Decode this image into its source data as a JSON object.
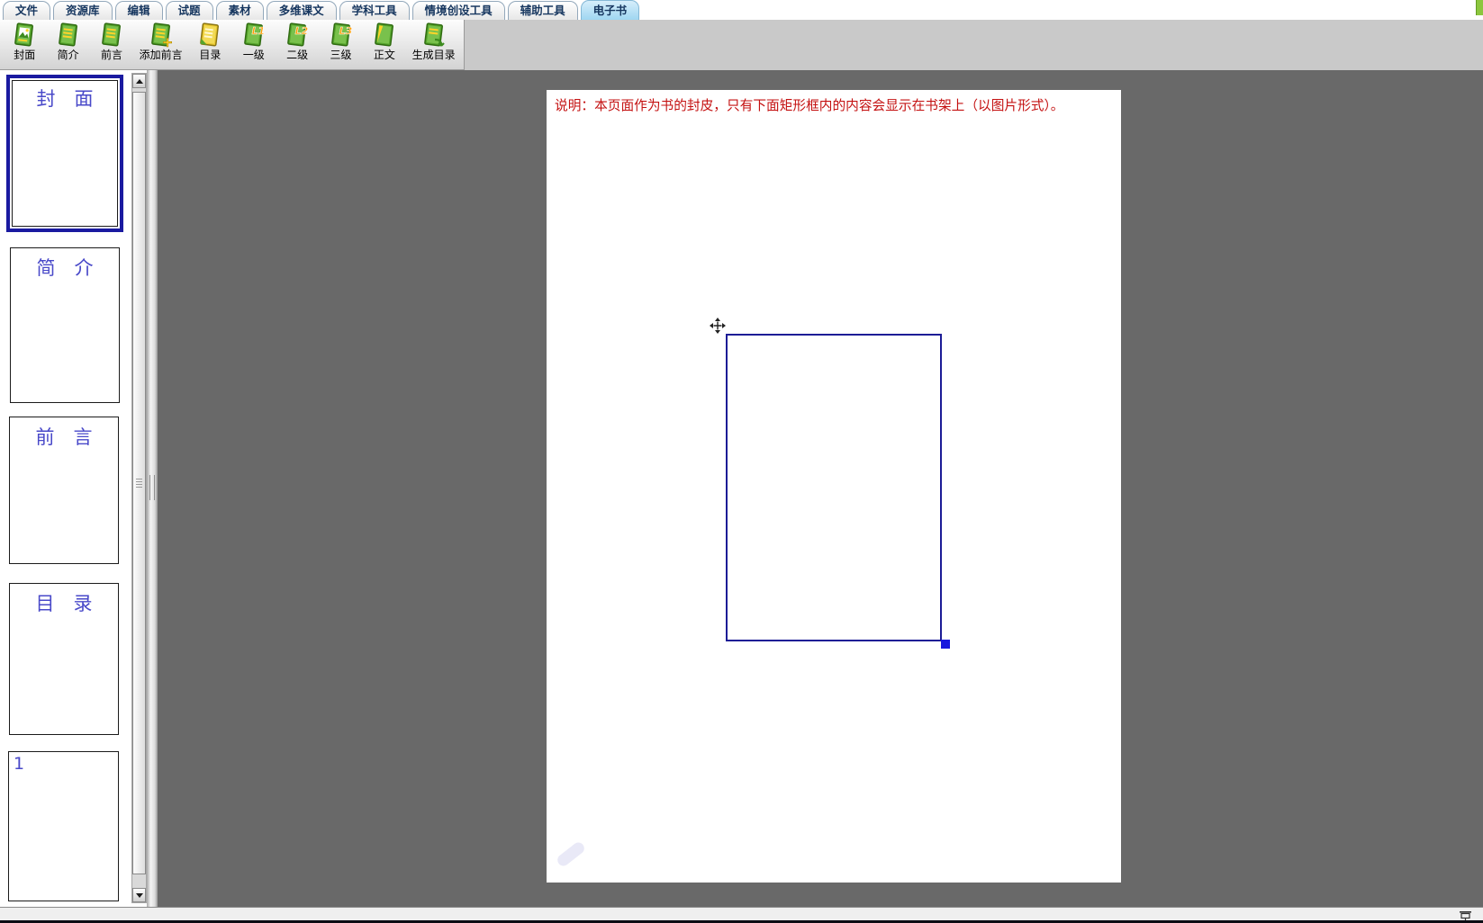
{
  "tabs": [
    {
      "id": "file",
      "label": "文件",
      "active": false
    },
    {
      "id": "resource-library",
      "label": "资源库",
      "active": false
    },
    {
      "id": "edit",
      "label": "编辑",
      "active": false
    },
    {
      "id": "test-questions",
      "label": "试题",
      "active": false
    },
    {
      "id": "materials",
      "label": "素材",
      "active": false
    },
    {
      "id": "multidim-text",
      "label": "多维课文",
      "active": false
    },
    {
      "id": "subject-tools",
      "label": "学科工具",
      "active": false
    },
    {
      "id": "context-creation-tools",
      "label": "情境创设工具",
      "active": false
    },
    {
      "id": "aux-tools",
      "label": "辅助工具",
      "active": false
    },
    {
      "id": "ebook",
      "label": "电子书",
      "active": true
    }
  ],
  "toolbar": {
    "buttons": [
      {
        "id": "cover",
        "label": "封面",
        "icon": "cover-page-icon",
        "style": "cover",
        "wide": false
      },
      {
        "id": "intro",
        "label": "简介",
        "icon": "intro-page-icon",
        "style": "lines",
        "wide": false
      },
      {
        "id": "preface",
        "label": "前言",
        "icon": "preface-page-icon",
        "style": "lines",
        "wide": false
      },
      {
        "id": "add-preface",
        "label": "添加前言",
        "icon": "add-preface-icon",
        "style": "add",
        "wide": true
      },
      {
        "id": "toc",
        "label": "目录",
        "icon": "toc-page-icon",
        "style": "toc",
        "wide": false
      },
      {
        "id": "level-1",
        "label": "一级",
        "icon": "level1-icon",
        "style": "level",
        "badge": "L1",
        "wide": false
      },
      {
        "id": "level-2",
        "label": "二级",
        "icon": "level2-icon",
        "style": "level",
        "badge": "L2",
        "wide": false
      },
      {
        "id": "level-3",
        "label": "三级",
        "icon": "level3-icon",
        "style": "level",
        "badge": "L3",
        "wide": false
      },
      {
        "id": "body-text",
        "label": "正文",
        "icon": "body-page-icon",
        "style": "plain",
        "wide": false
      },
      {
        "id": "generate-toc",
        "label": "生成目录",
        "icon": "generate-toc-icon",
        "style": "gen",
        "wide": true
      }
    ]
  },
  "sidebar": {
    "thumbnails": [
      {
        "id": "cover",
        "label": "封　面",
        "selected": true,
        "align": "center"
      },
      {
        "id": "intro",
        "label": "简　介",
        "selected": false,
        "align": "center"
      },
      {
        "id": "preface",
        "label": "前　言",
        "selected": false,
        "align": "center"
      },
      {
        "id": "toc",
        "label": "目　录",
        "selected": false,
        "align": "center"
      },
      {
        "id": "page-1",
        "label": "1",
        "selected": false,
        "align": "left"
      }
    ]
  },
  "canvas": {
    "note": "说明：本页面作为书的封皮，只有下面矩形框内的内容会显示在书架上（以图片形式）。"
  },
  "colors": {
    "active_tab": "#9fd6f1",
    "canvas_bg": "#696969",
    "note_red": "#c41111",
    "thumb_text": "#4949c9",
    "selected_thumb_border": "#1a1aa0",
    "selection_rect_border": "#1c1c96",
    "selection_handle": "#1717dd",
    "icon_green": "#55a42c",
    "icon_yellow": "#ffd42a"
  }
}
